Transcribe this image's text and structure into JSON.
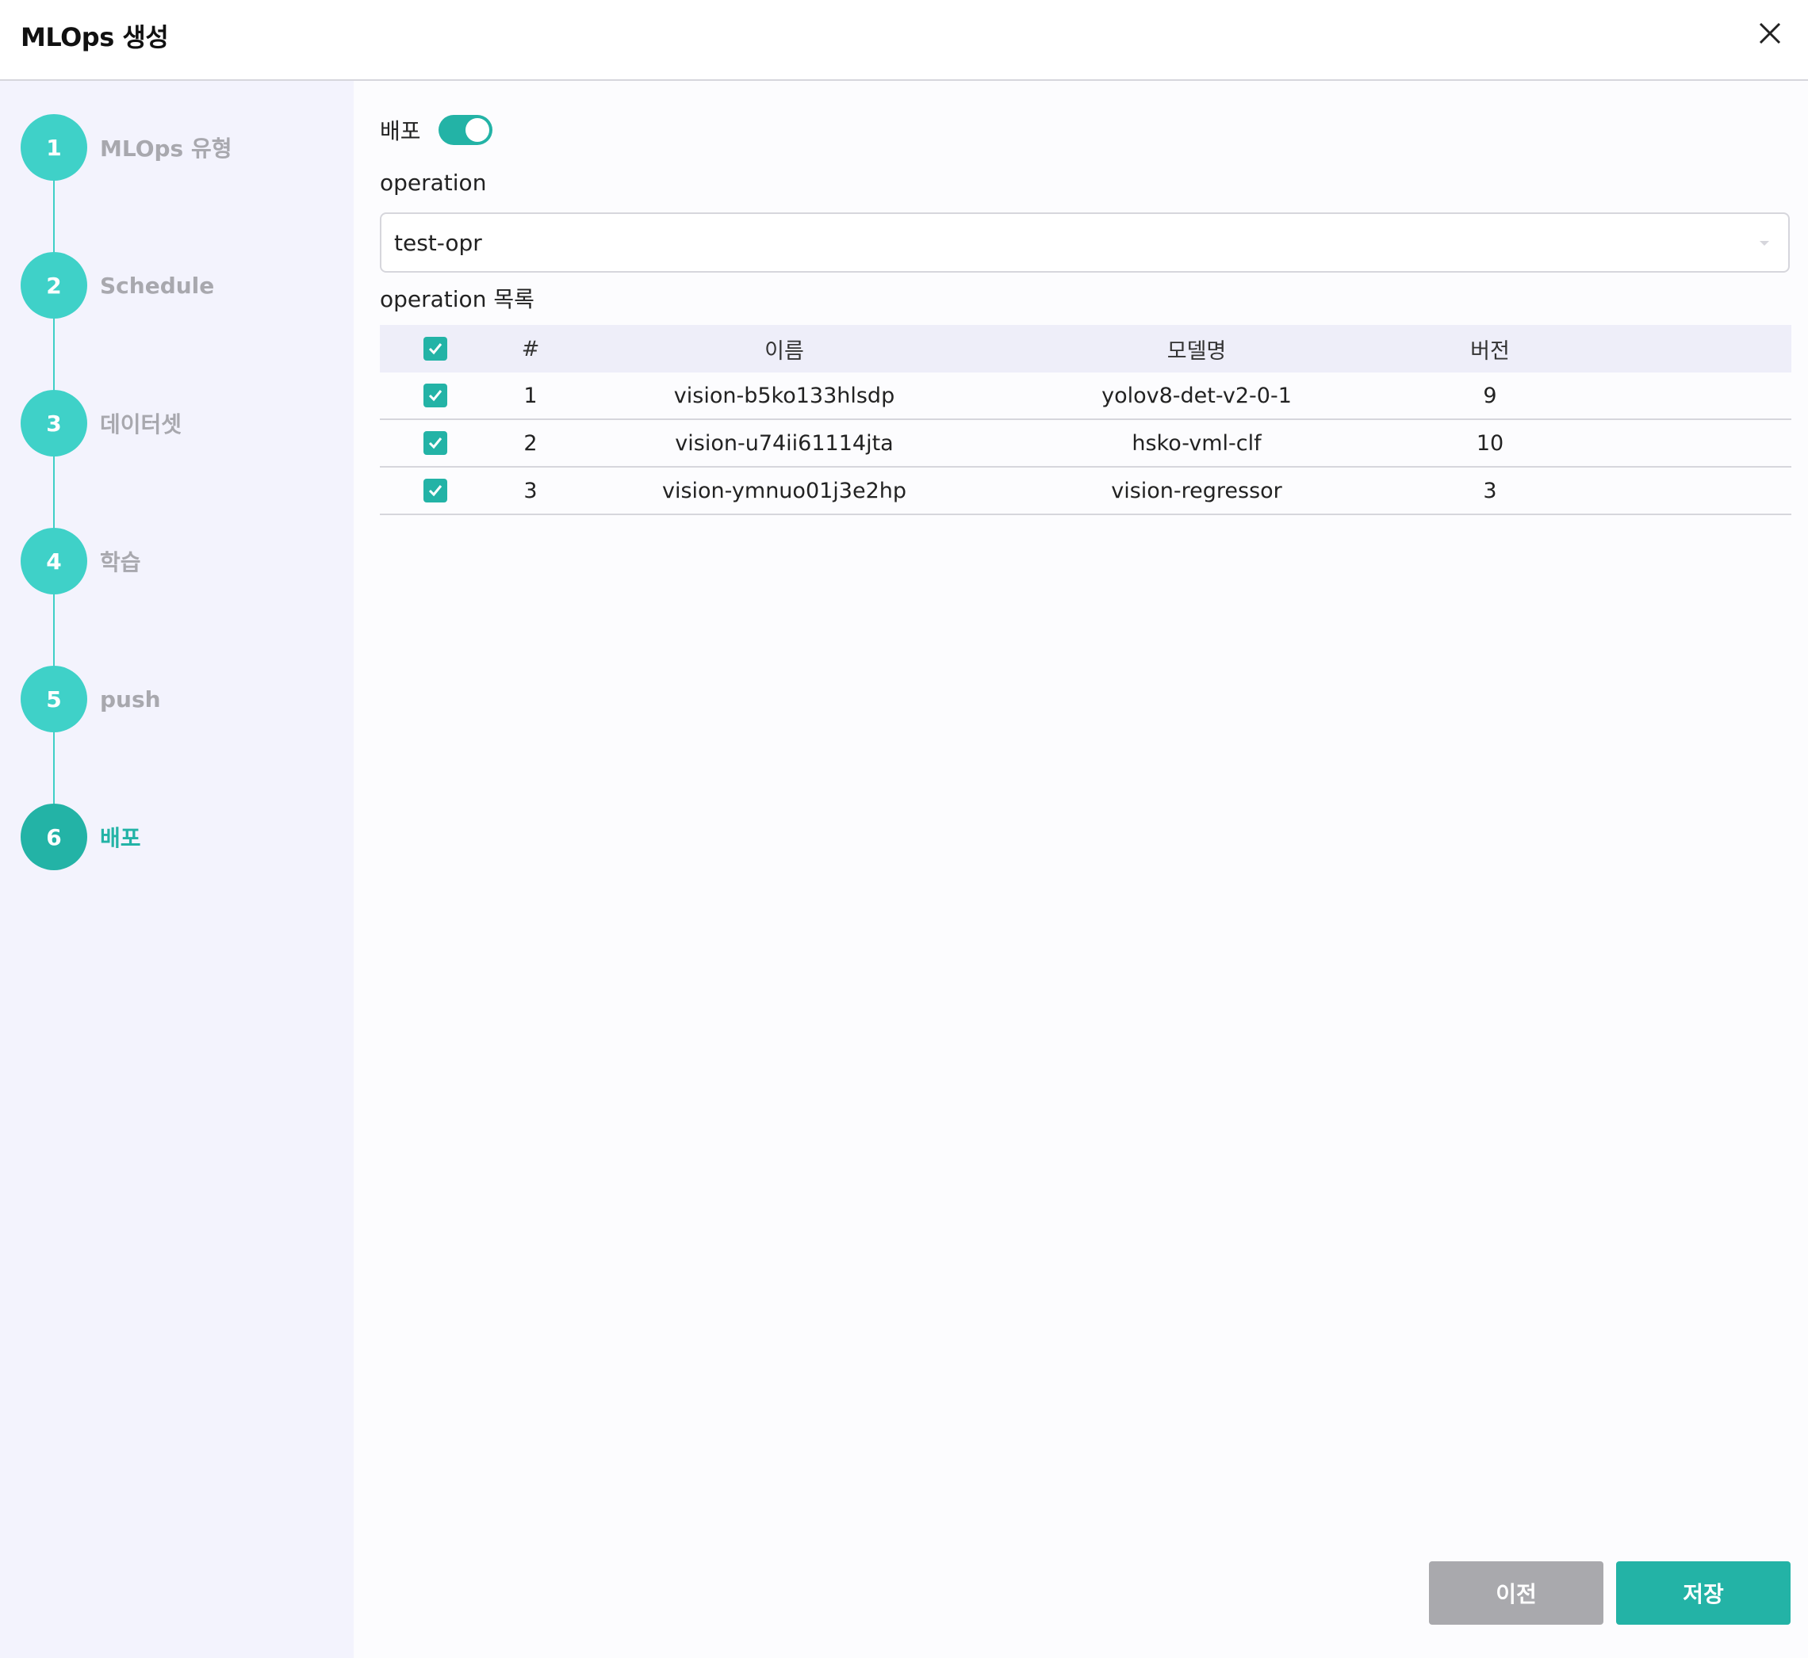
{
  "header": {
    "title": "MLOps 생성"
  },
  "steps": [
    {
      "number": "1",
      "label": "MLOps 유형"
    },
    {
      "number": "2",
      "label": "Schedule"
    },
    {
      "number": "3",
      "label": "데이터셋"
    },
    {
      "number": "4",
      "label": "학습"
    },
    {
      "number": "5",
      "label": "push"
    },
    {
      "number": "6",
      "label": "배포"
    }
  ],
  "active_step": "6",
  "deploy": {
    "label": "배포",
    "enabled": true
  },
  "operation": {
    "label": "operation",
    "value": "test-opr"
  },
  "operation_list": {
    "label": "operation 목록",
    "columns": [
      "#",
      "이름",
      "모델명",
      "버전"
    ],
    "rows": [
      {
        "num": "1",
        "name": "vision-b5ko133hlsdp",
        "model": "yolov8-det-v2-0-1",
        "version": "9",
        "checked": true
      },
      {
        "num": "2",
        "name": "vision-u74ii61114jta",
        "model": "hsko-vml-clf",
        "version": "10",
        "checked": true
      },
      {
        "num": "3",
        "name": "vision-ymnuo01j3e2hp",
        "model": "vision-regressor",
        "version": "3",
        "checked": true
      }
    ]
  },
  "buttons": {
    "prev": "이전",
    "save": "저장"
  },
  "colors": {
    "accent": "#23b3a6",
    "step": "#3fd1c8",
    "sidebar_bg": "#f3f3fd",
    "disabled": "#a9a9ad"
  },
  "icons": {
    "close": "close-icon",
    "check": "checkmark-icon",
    "caret": "chevron-down-icon"
  }
}
